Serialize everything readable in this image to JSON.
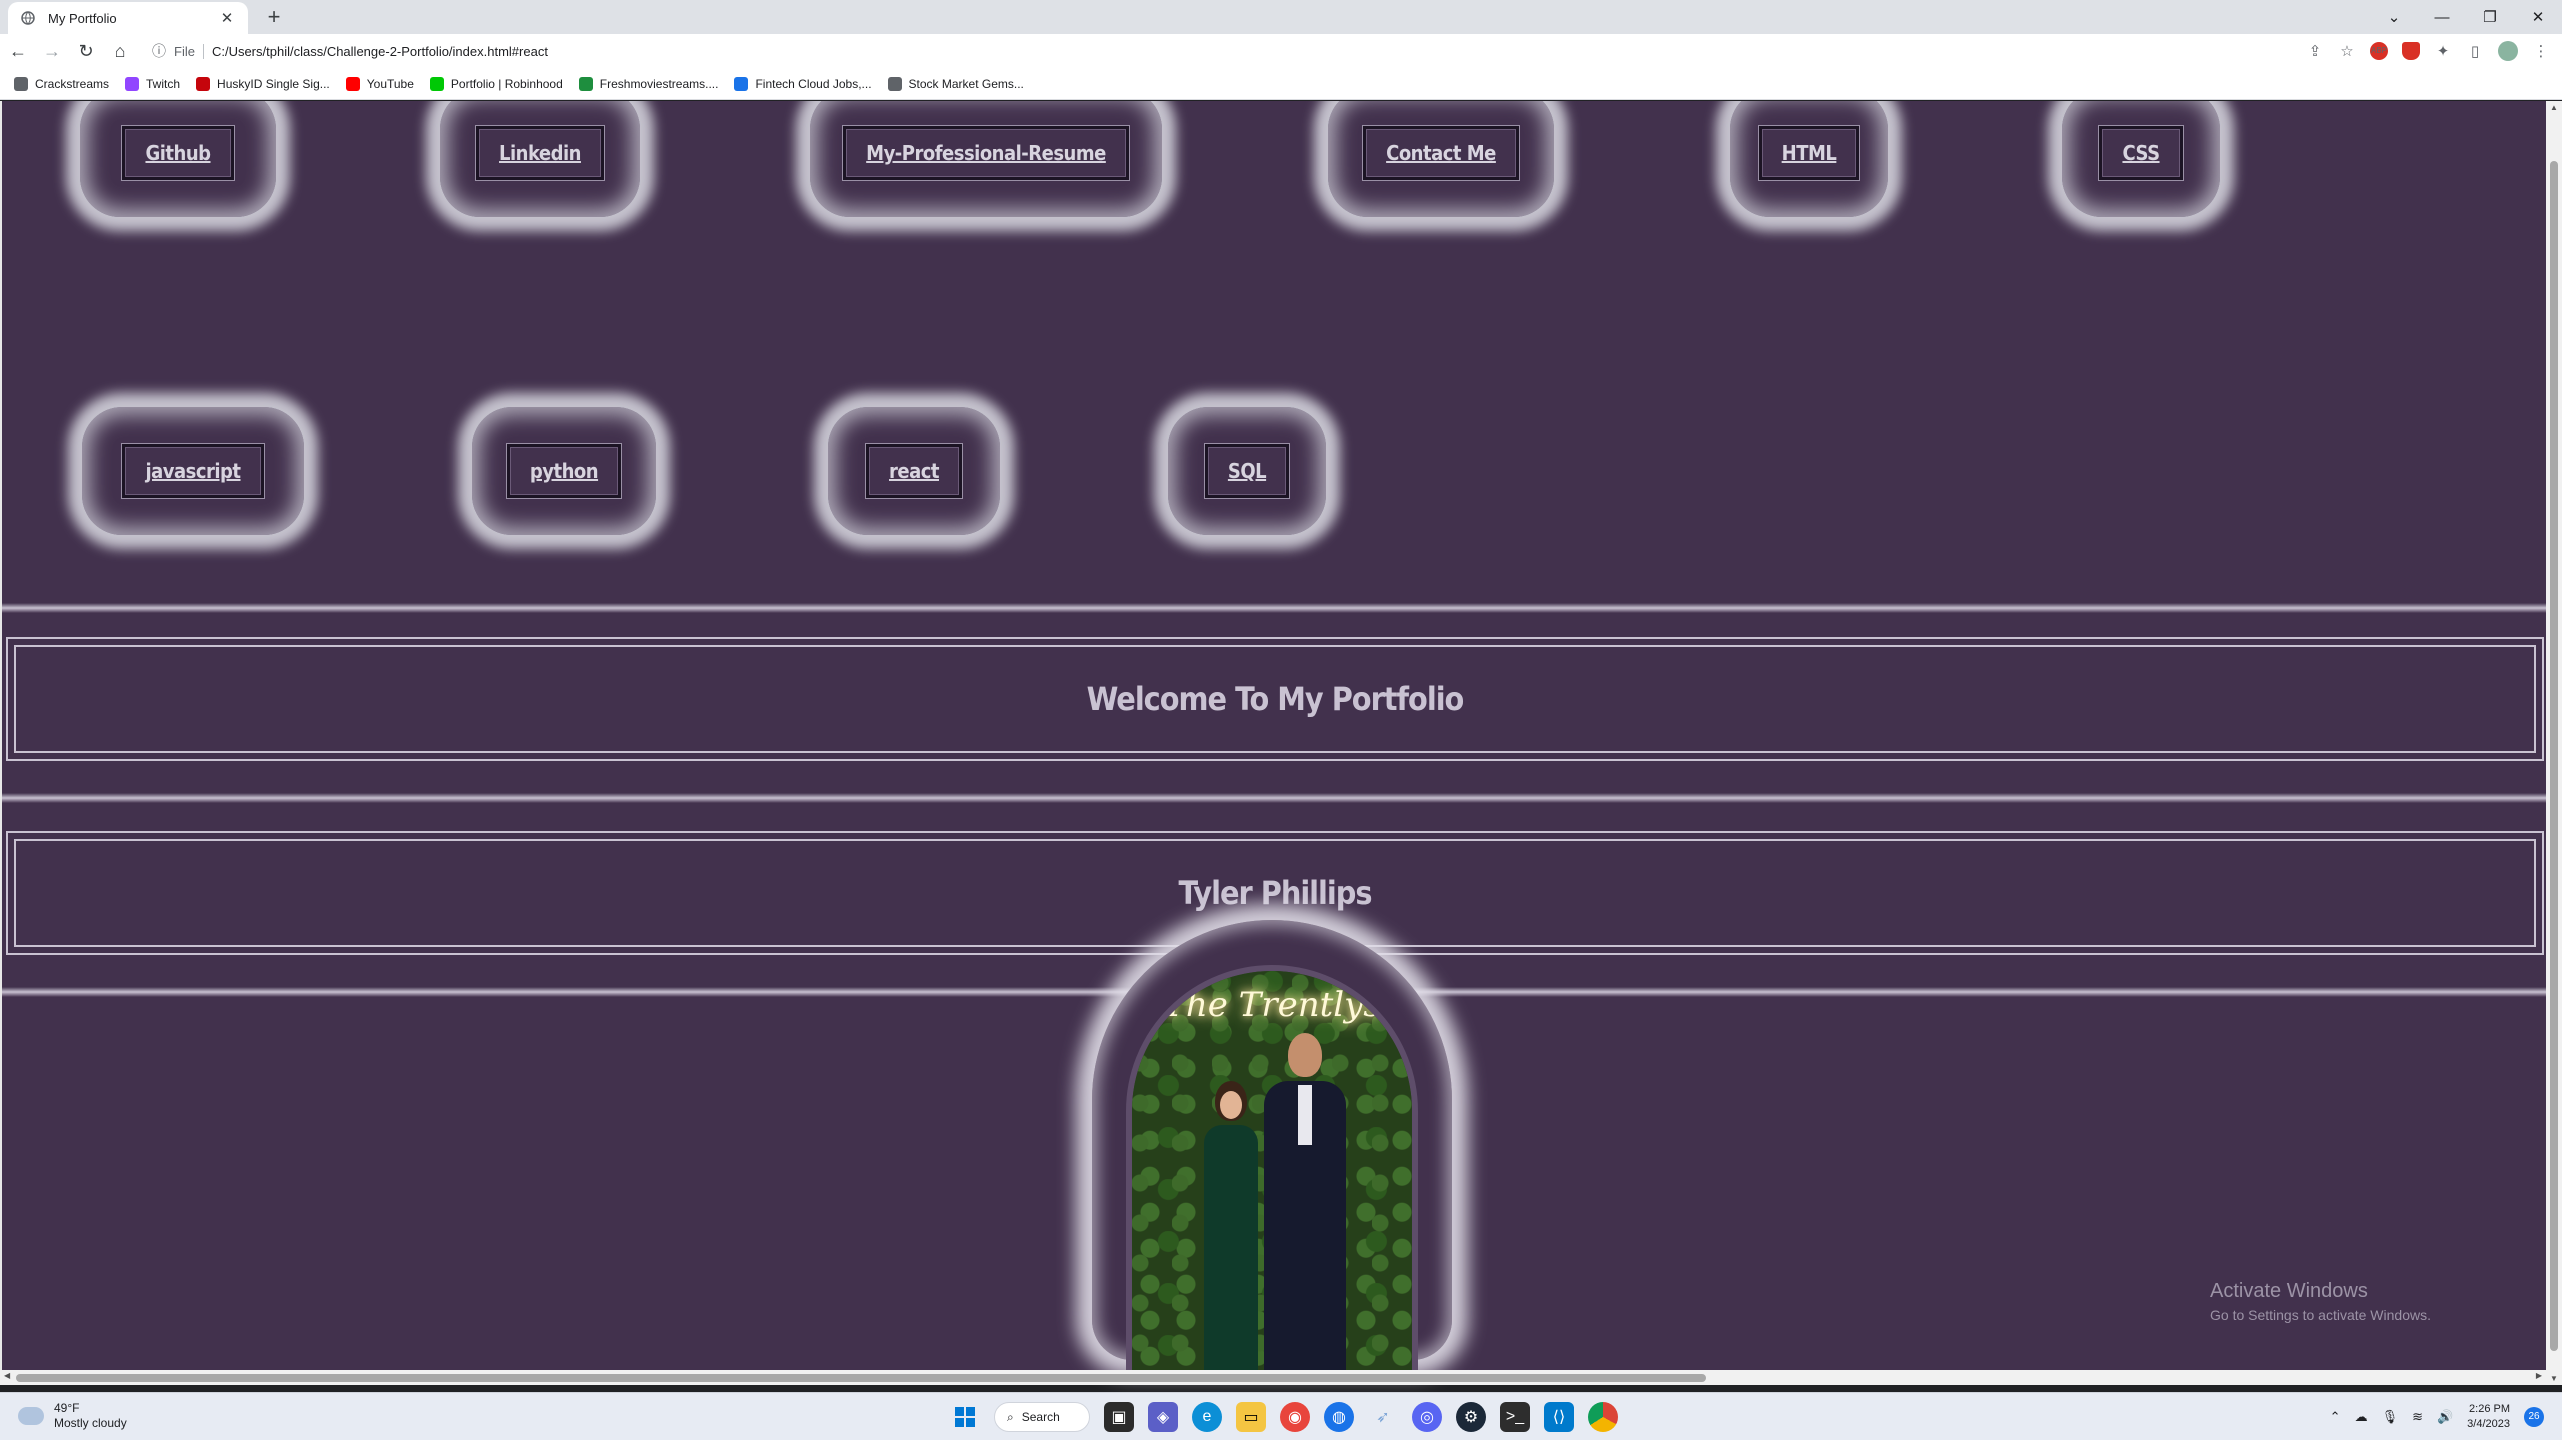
{
  "browser": {
    "tab_title": "My Portfolio",
    "url_scheme": "File",
    "url": "C:/Users/tphil/class/Challenge-2-Portfolio/index.html#react",
    "bookmarks": [
      {
        "label": "Crackstreams",
        "icon": "globe-icon",
        "color": "#5f6368"
      },
      {
        "label": "Twitch",
        "icon": "twitch-icon",
        "color": "#9146ff"
      },
      {
        "label": "HuskyID Single Sig...",
        "icon": "husky-icon",
        "color": "#c5050c"
      },
      {
        "label": "YouTube",
        "icon": "youtube-icon",
        "color": "#ff0000"
      },
      {
        "label": "Portfolio | Robinhood",
        "icon": "robinhood-icon",
        "color": "#00c805"
      },
      {
        "label": "Freshmoviestreams....",
        "icon": "play-icon",
        "color": "#1e8e3e"
      },
      {
        "label": "Fintech Cloud Jobs,...",
        "icon": "fintech-icon",
        "color": "#1a73e8"
      },
      {
        "label": "Stock Market Gems...",
        "icon": "globe-icon",
        "color": "#5f6368"
      }
    ]
  },
  "page": {
    "nav_row1": [
      "Github",
      "Linkedin",
      "My-Professional-Resume",
      "Contact Me",
      "HTML",
      "CSS"
    ],
    "nav_row2": [
      "javascript",
      "python",
      "react",
      "SQL"
    ],
    "welcome_heading": "Welcome To My Portfolio",
    "name_heading": "Tyler Phillips",
    "photo_sign": "The Trentlys"
  },
  "watermark": {
    "line1": "Activate Windows",
    "line2": "Go to Settings to activate Windows."
  },
  "taskbar": {
    "temperature": "49°F",
    "weather": "Mostly cloudy",
    "search_label": "Search",
    "time": "2:26 PM",
    "date": "3/4/2023",
    "notifications": "26"
  },
  "colors": {
    "page_bg": "#42314d",
    "glow": "#dcdce4",
    "text_light": "#d8d4df"
  }
}
